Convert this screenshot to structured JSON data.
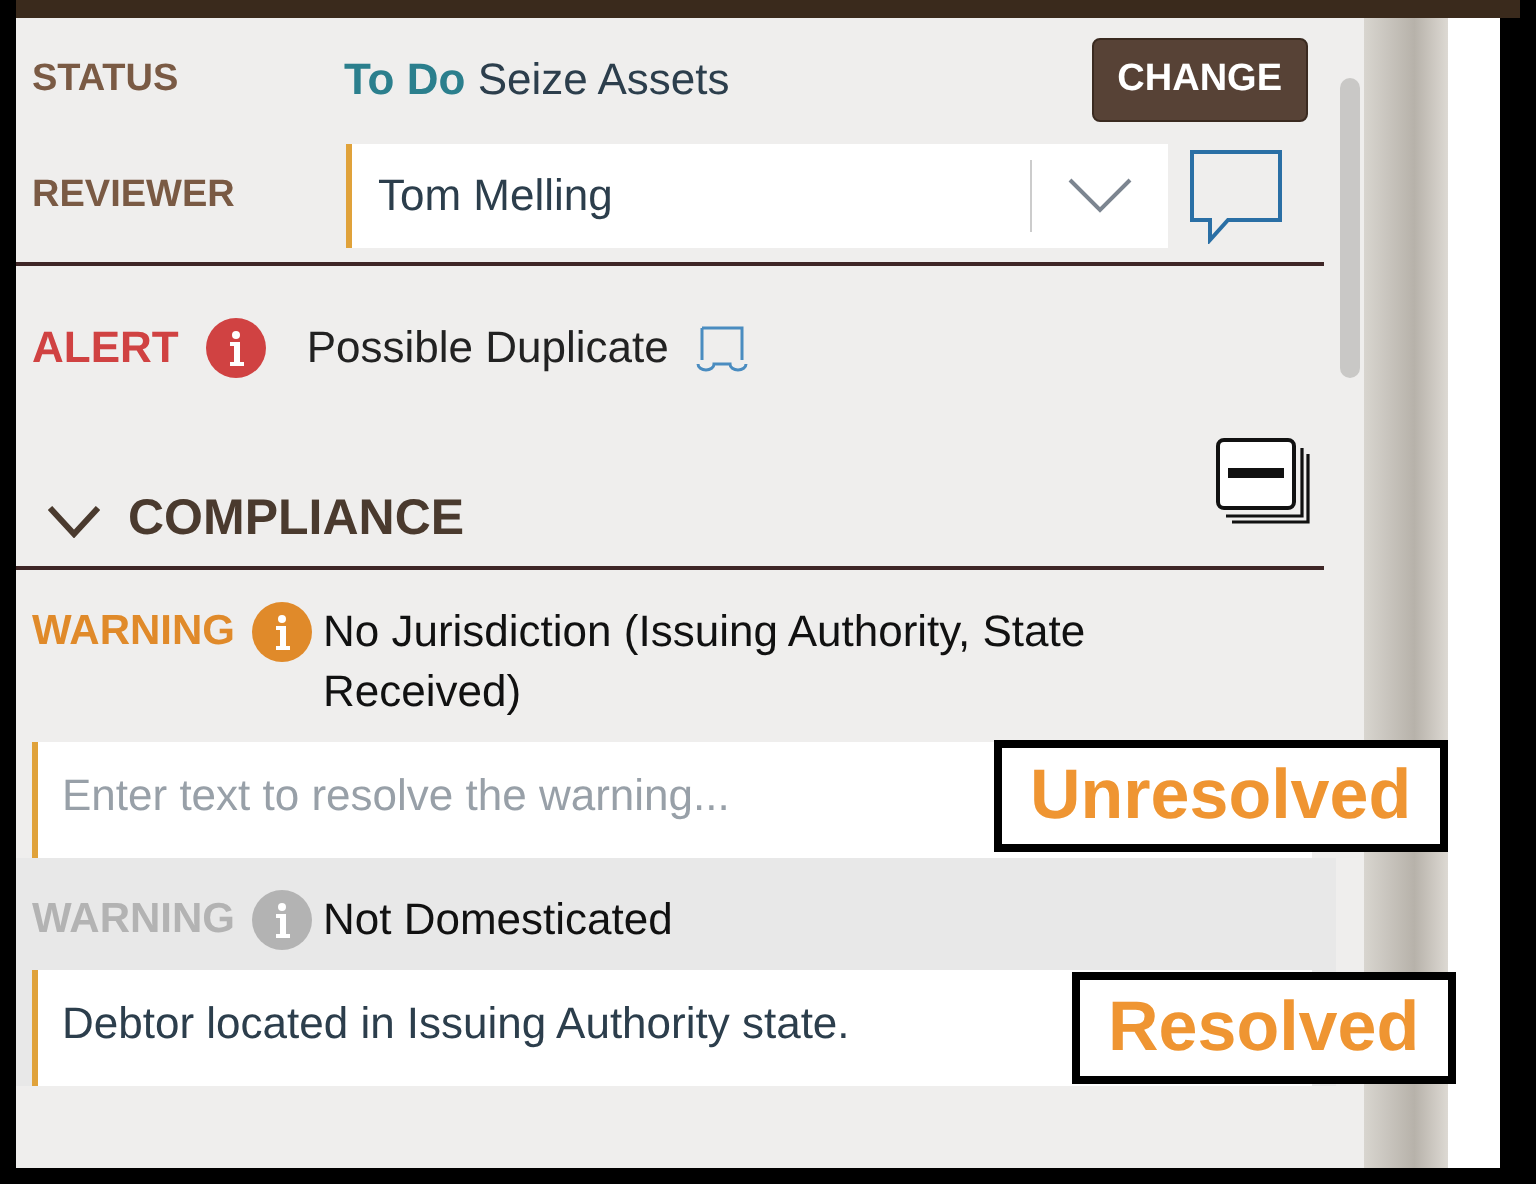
{
  "status": {
    "label": "STATUS",
    "state": "To Do",
    "task": "Seize Assets",
    "button": "CHANGE"
  },
  "reviewer": {
    "label": "REVIEWER",
    "value": "Tom Melling"
  },
  "alert": {
    "label": "ALERT",
    "text": "Possible Duplicate"
  },
  "section": {
    "title": "COMPLIANCE",
    "expanded": true
  },
  "warnings": [
    {
      "label": "WARNING",
      "text": "No Jurisdiction (Issuing Authority, State Received)",
      "resolved": false,
      "placeholder": "Enter text to resolve the warning..."
    },
    {
      "label": "WARNING",
      "text": "Not Domesticated",
      "resolved": true,
      "value": "Debtor located in Issuing Authority state."
    }
  ],
  "callouts": [
    "Unresolved",
    "Resolved"
  ]
}
